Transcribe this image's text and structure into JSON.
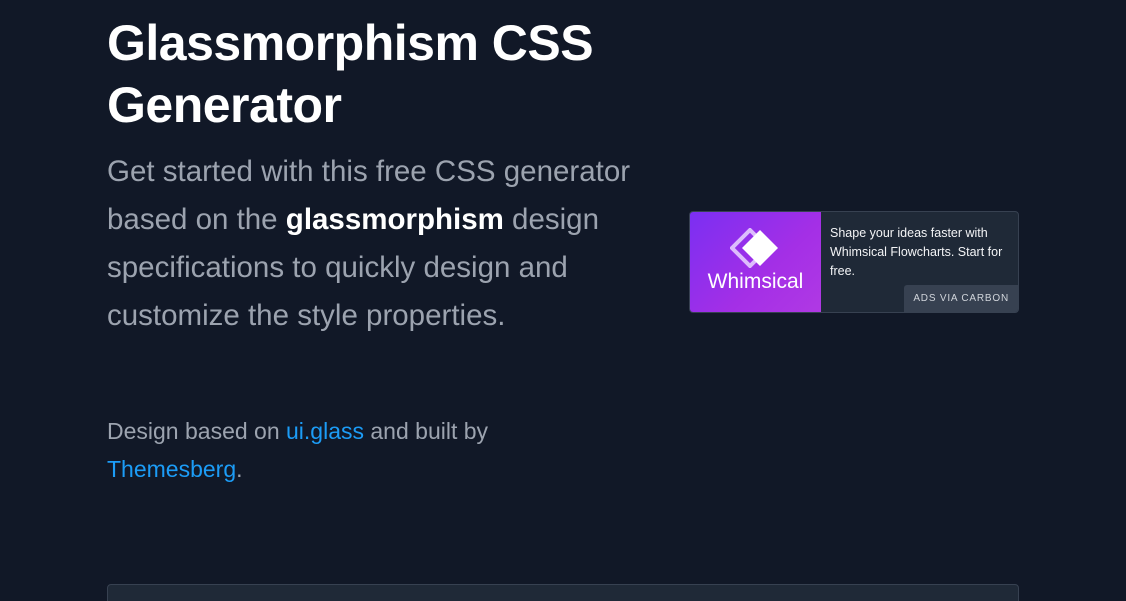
{
  "hero": {
    "title_line1": "Glassmorphism CSS",
    "title_line2": "Generator",
    "subtitle_part1": "Get started with this free CSS generator based on the",
    "subtitle_strong": "glassmorphism",
    "subtitle_part2": "design specifications to quickly design and customize the style properties."
  },
  "credit": {
    "prefix": "Design based on",
    "link1": "ui.glass",
    "middle": "and built by",
    "link2": "Themesberg",
    "suffix": "."
  },
  "ad": {
    "brand": "Whimsical",
    "icon": "whimsical-logo-icon",
    "text": "Shape your ideas faster with Whimsical Flowcharts. Start for free.",
    "via": "ADS VIA CARBON",
    "gradient_start": "#7b2ff2",
    "gradient_end": "#b039e4"
  },
  "colors": {
    "background": "#111827",
    "link": "#1c9cf6",
    "muted_text": "#9ca3af"
  }
}
